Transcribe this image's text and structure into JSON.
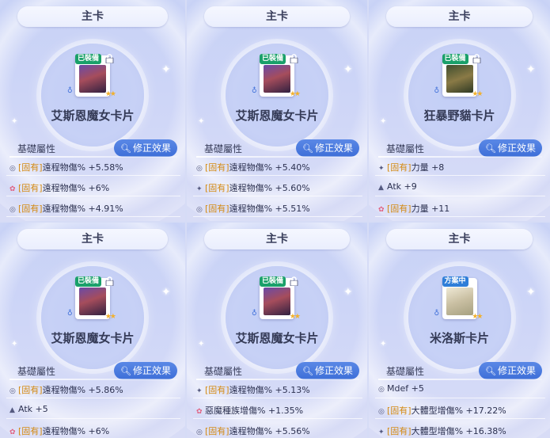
{
  "panels": [
    {
      "title": "主卡",
      "badge": "已裝備",
      "card_name": "艾斯恩魔女卡片",
      "section_label": "基礎屬性",
      "modify_label": "修正效果",
      "attrs": [
        {
          "icon": "circle-icon",
          "fixed": "[固有]",
          "text": "遠程物傷% +5.58%"
        },
        {
          "icon": "flower-icon",
          "fixed": "[固有]",
          "text": "遠程物傷% +6%"
        },
        {
          "icon": "circle-icon",
          "fixed": "[固有]",
          "text": "遠程物傷% +4.91%"
        }
      ]
    },
    {
      "title": "主卡",
      "badge": "已裝備",
      "card_name": "艾斯恩魔女卡片",
      "section_label": "基礎屬性",
      "modify_label": "修正效果",
      "attrs": [
        {
          "icon": "circle-icon",
          "fixed": "[固有]",
          "text": "遠程物傷% +5.40%"
        },
        {
          "icon": "star-icon",
          "fixed": "[固有]",
          "text": "遠程物傷% +5.60%"
        },
        {
          "icon": "circle-icon",
          "fixed": "[固有]",
          "text": "遠程物傷% +5.51%"
        }
      ]
    },
    {
      "title": "主卡",
      "badge": "已裝備",
      "card_name": "狂暴野貓卡片",
      "section_label": "基礎屬性",
      "modify_label": "修正效果",
      "attrs": [
        {
          "icon": "star-icon",
          "fixed": "[固有]",
          "text": "力量 +8"
        },
        {
          "icon": "triangle-icon",
          "fixed": "",
          "text": "Atk +9"
        },
        {
          "icon": "flower-icon",
          "fixed": "[固有]",
          "text": "力量 +11"
        }
      ]
    },
    {
      "title": "主卡",
      "badge": "已裝備",
      "card_name": "艾斯恩魔女卡片",
      "section_label": "基礎屬性",
      "modify_label": "修正效果",
      "attrs": [
        {
          "icon": "circle-icon",
          "fixed": "[固有]",
          "text": "遠程物傷% +5.86%"
        },
        {
          "icon": "triangle-icon",
          "fixed": "",
          "text": "Atk +5"
        },
        {
          "icon": "flower-icon",
          "fixed": "[固有]",
          "text": "遠程物傷% +6%"
        }
      ]
    },
    {
      "title": "主卡",
      "badge": "已裝備",
      "card_name": "艾斯恩魔女卡片",
      "section_label": "基礎屬性",
      "modify_label": "修正效果",
      "attrs": [
        {
          "icon": "star-icon",
          "fixed": "[固有]",
          "text": "遠程物傷% +5.13%"
        },
        {
          "icon": "flower-icon",
          "fixed": "",
          "text": "惡魔種族增傷% +1.35%"
        },
        {
          "icon": "circle-icon",
          "fixed": "[固有]",
          "text": "遠程物傷% +5.56%"
        }
      ]
    },
    {
      "title": "主卡",
      "badge": "方案中",
      "card_name": "米洛斯卡片",
      "section_label": "基礎屬性",
      "modify_label": "修正效果",
      "attrs": [
        {
          "icon": "circle-icon",
          "fixed": "",
          "text": "Mdef +5"
        },
        {
          "icon": "circle-icon",
          "fixed": "[固有]",
          "text": "大體型增傷% +17.22%"
        },
        {
          "icon": "star-icon",
          "fixed": "[固有]",
          "text": "大體型增傷% +16.38%"
        }
      ]
    }
  ]
}
